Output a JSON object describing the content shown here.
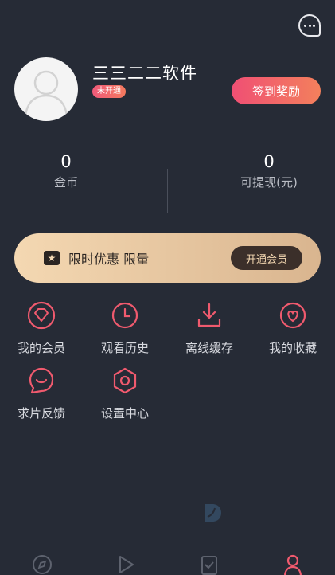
{
  "header": {
    "message_icon": "chat-bubble-icon"
  },
  "profile": {
    "username": "三三二二软件",
    "vip_badge": "未开通",
    "checkin_label": "签到奖励"
  },
  "stats": [
    {
      "value": "0",
      "label": "金币"
    },
    {
      "value": "0",
      "label": "可提现(元)"
    }
  ],
  "vip_banner": {
    "icon": "star-ticket-icon",
    "text": "限时优惠 限量",
    "button_label": "开通会员"
  },
  "menu": [
    {
      "label": "我的会员",
      "icon": "diamond-icon"
    },
    {
      "label": "观看历史",
      "icon": "clock-icon"
    },
    {
      "label": "离线缓存",
      "icon": "download-icon"
    },
    {
      "label": "我的收藏",
      "icon": "heart-icon"
    },
    {
      "label": "求片反馈",
      "icon": "feedback-bubble-icon"
    },
    {
      "label": "设置中心",
      "icon": "settings-icon"
    }
  ],
  "tabs": [
    {
      "icon": "compass-icon",
      "active": false
    },
    {
      "icon": "play-icon",
      "active": false
    },
    {
      "icon": "checklist-icon",
      "active": false
    },
    {
      "icon": "user-icon",
      "active": true
    }
  ],
  "colors": {
    "accent": "#f05a6e",
    "background": "#262b36",
    "vip_gold": "#f4d8b2"
  }
}
